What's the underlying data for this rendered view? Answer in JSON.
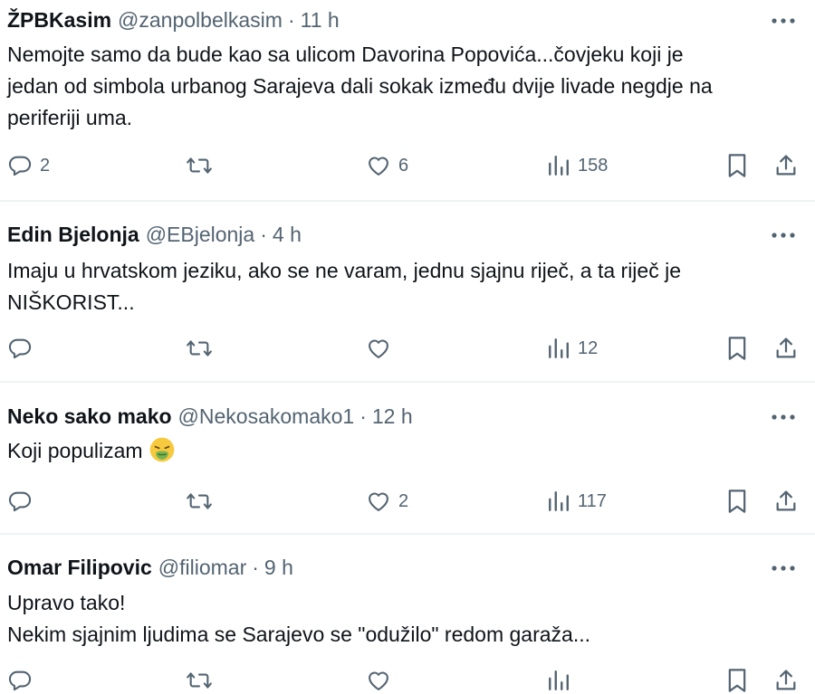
{
  "tweets": [
    {
      "name": "ŽPBKasim",
      "handle": "@zanpolbelkasim",
      "separator": "·",
      "time": "11 h",
      "lines": [
        "Nemojte samo da bude kao sa ulicom Davorina Popovića...čovjeku koji je",
        "jedan od simbola urbanog Sarajeva dali sokak između dvije livade negdje na",
        "periferiji uma."
      ],
      "replies": "2",
      "retweets": "",
      "likes": "6",
      "views": "158"
    },
    {
      "name": "Edin Bjelonja",
      "handle": "@EBjelonja",
      "separator": "·",
      "time": "4 h",
      "lines": [
        "Imaju u hrvatskom jeziku, ako se ne varam, jednu sjajnu riječ, a ta riječ je",
        "NIŠKORIST..."
      ],
      "replies": "",
      "retweets": "",
      "likes": "",
      "views": "12"
    },
    {
      "name": "Neko sako mako",
      "handle": "@Nekosakomako1",
      "separator": "·",
      "time": "12 h",
      "lines": [
        "Koji populizam"
      ],
      "emoji": "nauseated-face-emoji",
      "replies": "",
      "retweets": "",
      "likes": "2",
      "views": "117"
    },
    {
      "name": "Omar Filipovic",
      "handle": "@filiomar",
      "separator": "·",
      "time": "9 h",
      "lines": [
        "Upravo tako!",
        "Nekim sjajnim ljudima se Sarajevo se \"odužilo\" redom garaža..."
      ],
      "replies": "",
      "retweets": "",
      "likes": "",
      "views": ""
    }
  ],
  "icons": {
    "more": "more-horizontal-icon",
    "reply": "reply-bubble-icon",
    "retweet": "retweet-icon",
    "like": "heart-icon",
    "views": "views-chart-icon",
    "bookmark": "bookmark-icon",
    "share": "share-upload-icon"
  },
  "colors": {
    "text": "#0f1419",
    "secondary": "#536471",
    "divider": "#eff3f4"
  }
}
